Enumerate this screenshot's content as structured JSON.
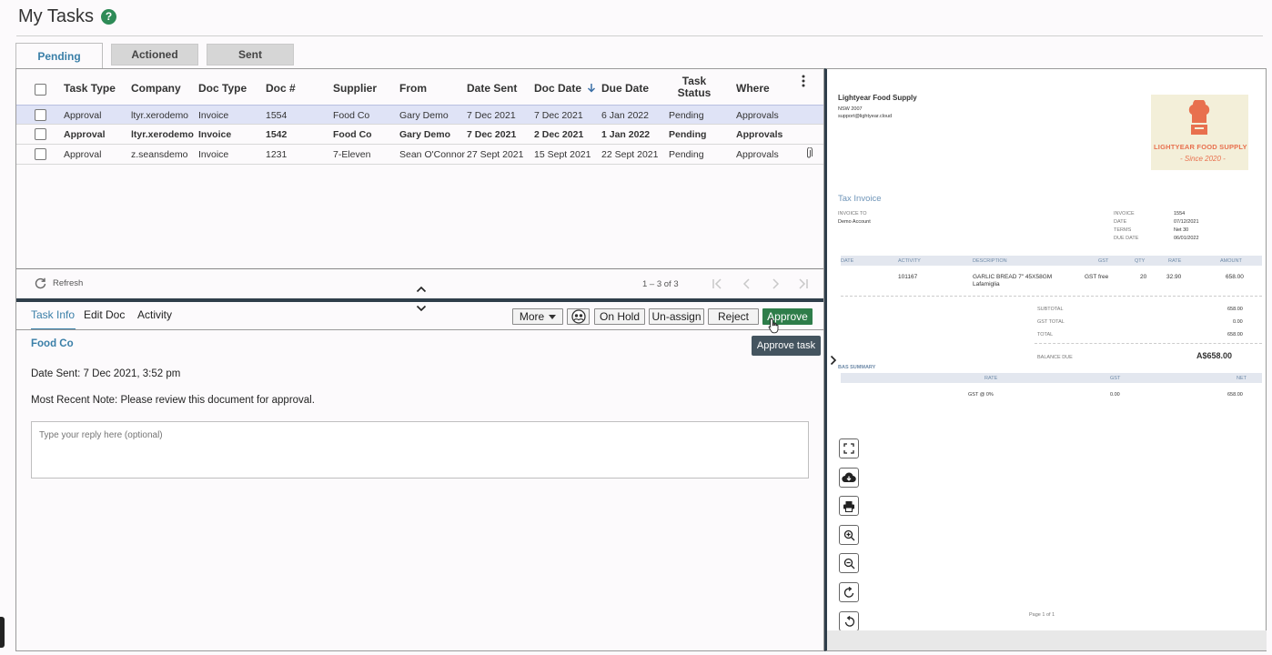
{
  "header": {
    "title": "My Tasks",
    "help_icon": "?"
  },
  "tabs": [
    "Pending",
    "Actioned",
    "Sent"
  ],
  "table": {
    "columns": [
      "Task Type",
      "Company",
      "Doc Type",
      "Doc #",
      "Supplier",
      "From",
      "Date Sent",
      "Doc Date",
      "Due Date",
      "Task Status",
      "Where"
    ],
    "rows": [
      [
        "Approval",
        "ltyr.xerodemo",
        "Invoice",
        "1554",
        "Food Co",
        "Gary Demo",
        "7 Dec 2021",
        "7 Dec 2021",
        "6 Jan 2022",
        "Pending",
        "Approvals"
      ],
      [
        "Approval",
        "ltyr.xerodemo",
        "Invoice",
        "1542",
        "Food Co",
        "Gary Demo",
        "7 Dec 2021",
        "2 Dec 2021",
        "1 Jan 2022",
        "Pending",
        "Approvals"
      ],
      [
        "Approval",
        "z.seansdemo",
        "Invoice",
        "1231",
        "7-Eleven",
        "Sean O'Connor",
        "27 Sept 2021",
        "15 Sept 2021",
        "22 Sept 2021",
        "Pending",
        "Approvals"
      ]
    ]
  },
  "list_footer": {
    "refresh": "Refresh",
    "pagination": "1 – 3 of 3"
  },
  "detail": {
    "tabs": [
      "Task Info",
      "Edit Doc",
      "Activity"
    ],
    "buttons": {
      "more": "More",
      "on_hold": "On Hold",
      "unassign": "Un-assign",
      "reject": "Reject",
      "approve": "Approve"
    },
    "tooltip": "Approve task",
    "supplier": "Food Co",
    "date_sent_label": "Date Sent:",
    "date_sent": "7 Dec 2021, 3:52 pm",
    "note_label": "Most Recent Note:",
    "note": "Please review this document for approval.",
    "reply_placeholder": "Type your reply here (optional)"
  },
  "invoice": {
    "company": "Lightyear Food Supply",
    "addr1": "NSW  2007",
    "addr2": "support@lightyear.cloud",
    "logo_text": "LIGHTYEAR FOOD SUPPLY",
    "logo_sub": "- Since 2020 -",
    "doc_title": "Tax Invoice",
    "invoice_to_label": "INVOICE TO",
    "invoice_to": "Demo Account",
    "meta_labels": [
      "INVOICE",
      "DATE",
      "TERMS",
      "DUE DATE"
    ],
    "meta_values": [
      "1554",
      "07/12/2021",
      "Net 30",
      "06/01/2022"
    ],
    "line_headers": [
      "DATE",
      "ACTIVITY",
      "DESCRIPTION",
      "GST",
      "QTY",
      "RATE",
      "AMOUNT"
    ],
    "line": {
      "activity": "101167",
      "desc1": "GARLIC BREAD 7\" 45X58GM",
      "desc2": "Lafamiglia",
      "gst": "GST free",
      "qty": "20",
      "rate": "32.90",
      "amount": "658.00"
    },
    "totals": [
      [
        "SUBTOTAL",
        "658.00"
      ],
      [
        "GST TOTAL",
        "0.00"
      ],
      [
        "TOTAL",
        "658.00"
      ]
    ],
    "balance_label": "BALANCE DUE",
    "balance": "A$658.00",
    "bas_title": "BAS SUMMARY",
    "bas_headers": [
      "RATE",
      "GST",
      "NET"
    ],
    "bas_row": [
      "GST @ 0%",
      "0.00",
      "658.00"
    ],
    "page": "Page 1 of 1"
  }
}
